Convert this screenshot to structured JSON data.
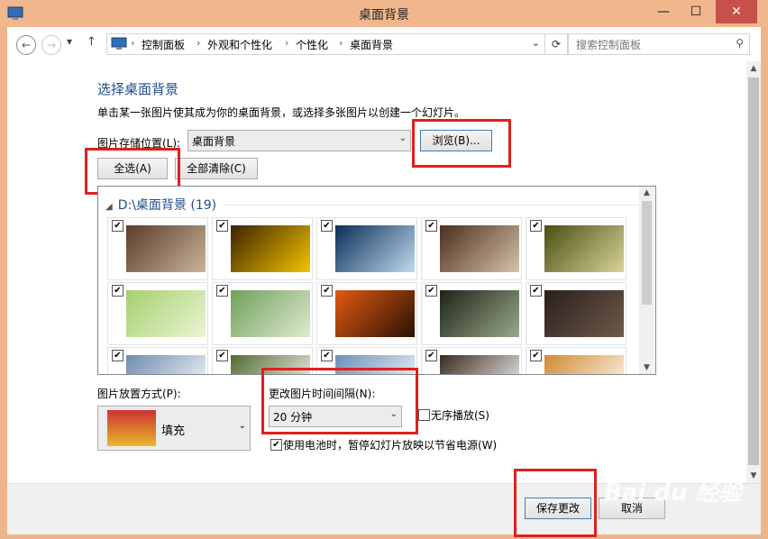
{
  "window": {
    "title": "桌面背景",
    "minimize": "—",
    "maximize": "☐",
    "close": "✕"
  },
  "address": {
    "back": "←",
    "forward": "→",
    "recent": "▾",
    "up": "↑",
    "crumbs": [
      "控制面板",
      "外观和个性化",
      "个性化",
      "桌面背景"
    ],
    "sep": "›",
    "dropdown": "⌄",
    "refresh": "⟳",
    "search_placeholder": "搜索控制面板",
    "search_icon": "⚲"
  },
  "main": {
    "heading": "选择桌面背景",
    "description": "单击某一张图片使其成为你的桌面背景，或选择多张图片以创建一个幻灯片。",
    "location_label": "图片存储位置(L):",
    "location_value": "桌面背景",
    "browse_button": "浏览(B)...",
    "select_all": "全选(A)",
    "clear_all": "全部清除(C)"
  },
  "gallery": {
    "group_header": "D:\\桌面背景 (19)",
    "collapse_glyph": "◢",
    "check_glyph": "✔",
    "thumbnails": [
      {
        "name": "arrows-wallpaper",
        "c1": "#5a3b2a",
        "c2": "#c9b49a",
        "checked": true
      },
      {
        "name": "golden-light",
        "c1": "#3a2300",
        "c2": "#f5c400",
        "checked": true
      },
      {
        "name": "blue-sky",
        "c1": "#0a2e57",
        "c2": "#bfd9ee",
        "checked": true
      },
      {
        "name": "arrows-wallpaper-2",
        "c1": "#4b2e1f",
        "c2": "#d6c3a8",
        "checked": true
      },
      {
        "name": "dandelion-field",
        "c1": "#4a4e12",
        "c2": "#d8d39a",
        "checked": true
      },
      {
        "name": "green-squares",
        "c1": "#a6d06b",
        "c2": "#eaf4d5",
        "checked": true
      },
      {
        "name": "green-bokeh",
        "c1": "#6fa05a",
        "c2": "#dfead0",
        "checked": true
      },
      {
        "name": "orange-sunset",
        "c1": "#e05a10",
        "c2": "#2a1205",
        "checked": true
      },
      {
        "name": "rain-window",
        "c1": "#1d2419",
        "c2": "#9aa88a",
        "checked": true
      },
      {
        "name": "circles-dark",
        "c1": "#2a1f1b",
        "c2": "#6e5a4c",
        "checked": true
      },
      {
        "name": "row3-a",
        "c1": "#6f8bb0",
        "c2": "#ffffff",
        "checked": true
      },
      {
        "name": "row3-b",
        "c1": "#556b2f",
        "c2": "#ffffff",
        "checked": true
      },
      {
        "name": "row3-c",
        "c1": "#6b8fb8",
        "c2": "#ffffff",
        "checked": true
      },
      {
        "name": "row3-d",
        "c1": "#3b2b1f",
        "c2": "#ffffff",
        "checked": true
      },
      {
        "name": "row3-e",
        "c1": "#d08a30",
        "c2": "#ffffff",
        "checked": true
      }
    ],
    "scroll_up": "▲",
    "scroll_down": "▼"
  },
  "options": {
    "position_label": "图片放置方式(P):",
    "position_value": "填充",
    "interval_label": "更改图片时间间隔(N):",
    "interval_value": "20 分钟",
    "shuffle_label": "无序播放(S)",
    "shuffle_checked": false,
    "battery_label": "使用电池时，暂停幻灯片放映以节省电源(W)",
    "battery_checked": true,
    "arrow": "⌄"
  },
  "footer": {
    "save": "保存更改",
    "cancel": "取消"
  },
  "watermark": "Bai du 经验"
}
